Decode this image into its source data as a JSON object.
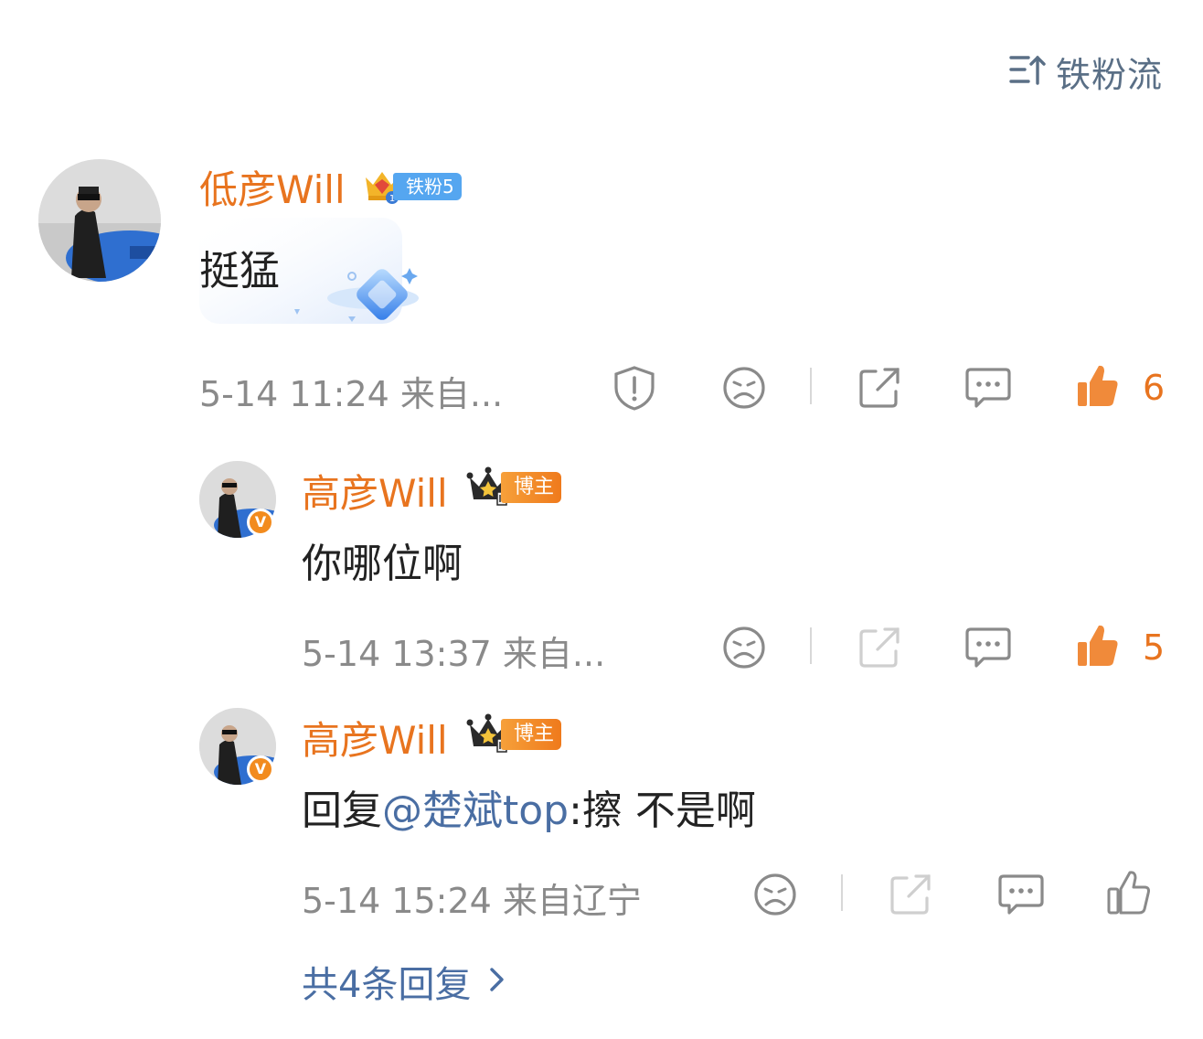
{
  "sort": {
    "label": "铁粉流",
    "icon": "sort-icon"
  },
  "comment": {
    "username": "低彦Will",
    "badge": {
      "icon": "fan-crown-icon",
      "label": "铁粉5",
      "color": "#55a6f0"
    },
    "content": "挺猛",
    "decoration": "diamond-sticker",
    "meta": "5-14 11:24  来自...",
    "actions": {
      "report_icon": "report-icon",
      "dislike_icon": "dislike-face-icon",
      "share_icon": "share-icon",
      "comment_icon": "comment-icon",
      "like_icon": "thumbs-up-icon",
      "like_count": "6"
    }
  },
  "replies": [
    {
      "username": "高彦Will",
      "badge": {
        "icon": "crown-icon",
        "label": "博主",
        "color": "#ef7a1c"
      },
      "verified_icon": "verified-v-icon",
      "content": "你哪位啊",
      "meta": "5-14 13:37  来自...",
      "like_count": "5"
    },
    {
      "username": "高彦Will",
      "badge": {
        "icon": "crown-icon",
        "label": "博主",
        "color": "#ef7a1c"
      },
      "verified_icon": "verified-v-icon",
      "content_prefix": "回复",
      "mention": "@楚斌top",
      "content_suffix": ":擦 不是啊",
      "meta": "5-14 15:24  来自辽宁",
      "like_count": ""
    }
  ],
  "more_replies": {
    "label": "共4条回复",
    "icon": "chevron-right-icon"
  },
  "colors": {
    "accent": "#e8741f",
    "link": "#4a6ea3",
    "meta": "#8a8a8a"
  },
  "verified_letter": "V"
}
